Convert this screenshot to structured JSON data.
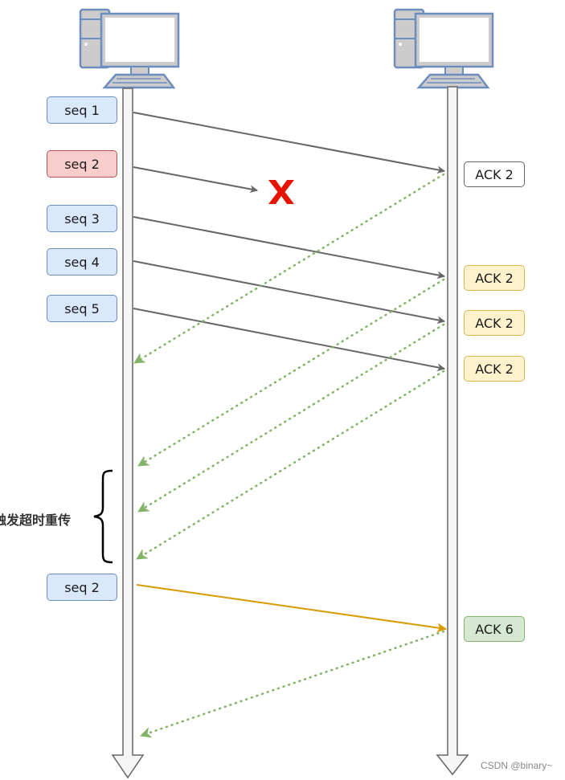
{
  "sender": {
    "name": "sender-computer"
  },
  "receiver": {
    "name": "receiver-computer"
  },
  "sender_packets": [
    {
      "label": "seq 1",
      "state": "sent",
      "color": "blue"
    },
    {
      "label": "seq 2",
      "state": "lost",
      "color": "red"
    },
    {
      "label": "seq 3",
      "state": "sent",
      "color": "blue"
    },
    {
      "label": "seq 4",
      "state": "sent",
      "color": "blue"
    },
    {
      "label": "seq 5",
      "state": "sent",
      "color": "blue"
    },
    {
      "label": "seq 2",
      "state": "retransmitted",
      "color": "blue"
    }
  ],
  "receiver_acks": [
    {
      "label": "ACK 2",
      "color": "white"
    },
    {
      "label": "ACK 2",
      "color": "yellow"
    },
    {
      "label": "ACK 2",
      "color": "yellow"
    },
    {
      "label": "ACK 2",
      "color": "yellow"
    },
    {
      "label": "ACK 6",
      "color": "green"
    }
  ],
  "lost_marker": "X",
  "annotation": "触发超时重传",
  "watermark": "CSDN @binary~",
  "colors": {
    "data_arrow": "#666666",
    "retransmit_arrow": "#d79b00",
    "ack_arrow": "#82b366",
    "lost_marker": "#e51400",
    "lifeline_fill": "#f5f5f5",
    "lifeline_stroke": "#666666"
  }
}
